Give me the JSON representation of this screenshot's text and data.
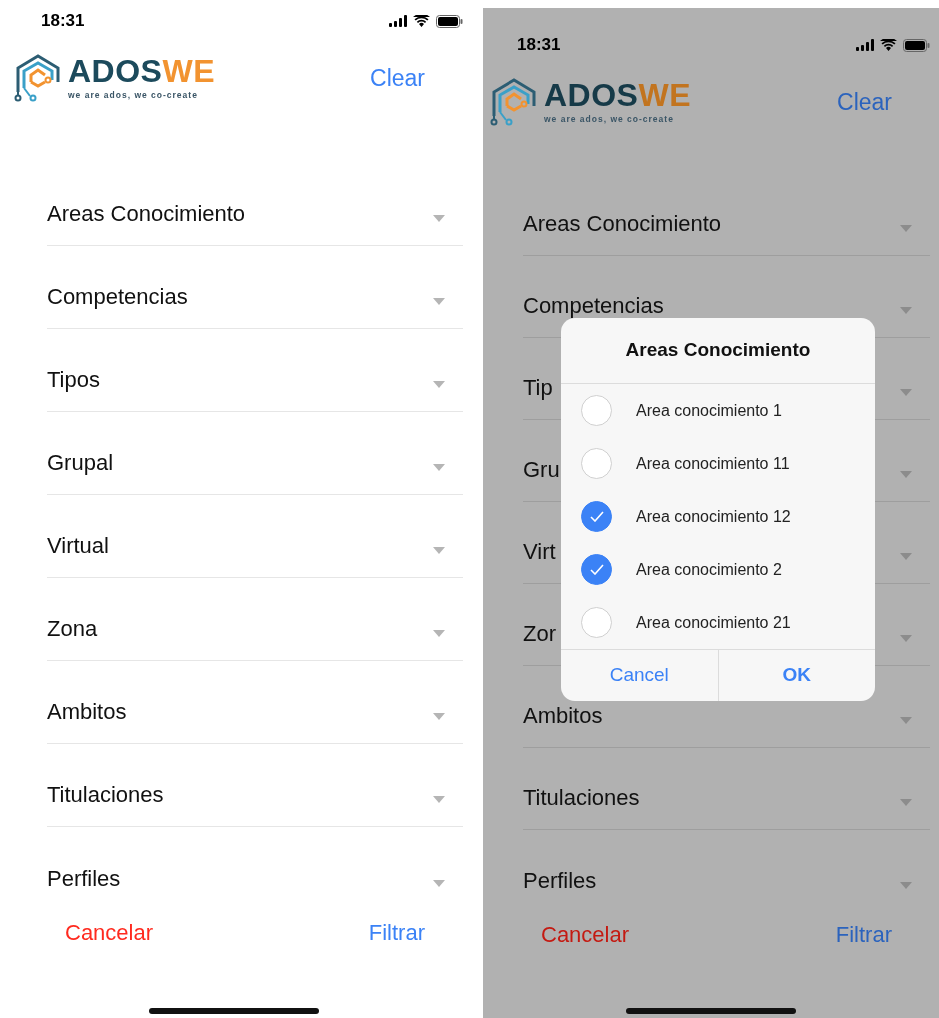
{
  "screens": [
    {
      "dimmed": false,
      "status_bar": {
        "time": "18:31"
      },
      "logo": {
        "word": "ADOS",
        "accent": "WE",
        "tagline": "we are ados, we co-create"
      },
      "clear": "Clear",
      "filters": [
        "Areas Conocimiento",
        "Competencias",
        "Tipos",
        "Grupal",
        "Virtual",
        "Zona",
        "Ambitos",
        "Titulaciones",
        "Perfiles"
      ],
      "cancel": "Cancelar",
      "submit": "Filtrar"
    },
    {
      "dimmed": true,
      "status_bar": {
        "time": "18:31"
      },
      "logo": {
        "word": "ADOS",
        "accent": "WE",
        "tagline": "we are ados, we co-create"
      },
      "clear": "Clear",
      "filters": [
        "Areas Conocimiento",
        "Competencias",
        "Tip",
        "Gru",
        "Virt",
        "Zor",
        "Ambitos",
        "Titulaciones",
        "Perfiles"
      ],
      "cancel": "Cancelar",
      "submit": "Filtrar",
      "dialog": {
        "title": "Areas Conocimiento",
        "options": [
          {
            "label": "Area conocimiento 1",
            "checked": false
          },
          {
            "label": "Area conocimiento 11",
            "checked": false
          },
          {
            "label": "Area conocimiento 12",
            "checked": true
          },
          {
            "label": "Area conocimiento 2",
            "checked": true
          },
          {
            "label": "Area conocimiento 21",
            "checked": false
          }
        ],
        "cancel": "Cancel",
        "ok": "OK"
      }
    }
  ]
}
